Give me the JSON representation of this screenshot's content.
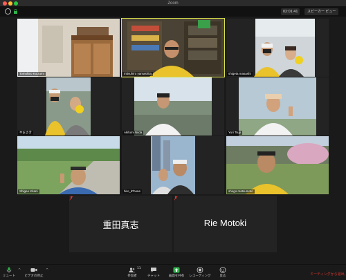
{
  "window": {
    "title": "Zoom"
  },
  "topbar": {
    "timer": "02:01:41",
    "view_label": "スピーカー ビュー"
  },
  "participants": [
    {
      "name": "Tomohiro Koizumi"
    },
    {
      "name": "mitsuhiro yamashita",
      "active": true
    },
    {
      "name": "shigeta masashi"
    },
    {
      "name": "やまさき"
    },
    {
      "name": "Akifumi Niida"
    },
    {
      "name": "Yuri Tsuji"
    },
    {
      "name": "Shigeo Kitani"
    },
    {
      "name": "hiro_iPhone"
    },
    {
      "name": "shogo matsumoto"
    },
    {
      "name": "重田真志"
    },
    {
      "name": "Rie Motoki"
    }
  ],
  "toolbar": {
    "mute": "ミュート",
    "video": "ビデオの停止",
    "participants": "参加者",
    "participants_count": "11",
    "chat": "チャット",
    "share": "画面を共有",
    "record": "レコーディング",
    "reactions": "反応",
    "leave": "ミーティングから退出"
  },
  "colors": {
    "active_border": "#d8e14a",
    "share_green": "#2fb34a",
    "leave_red": "#e2362e"
  }
}
